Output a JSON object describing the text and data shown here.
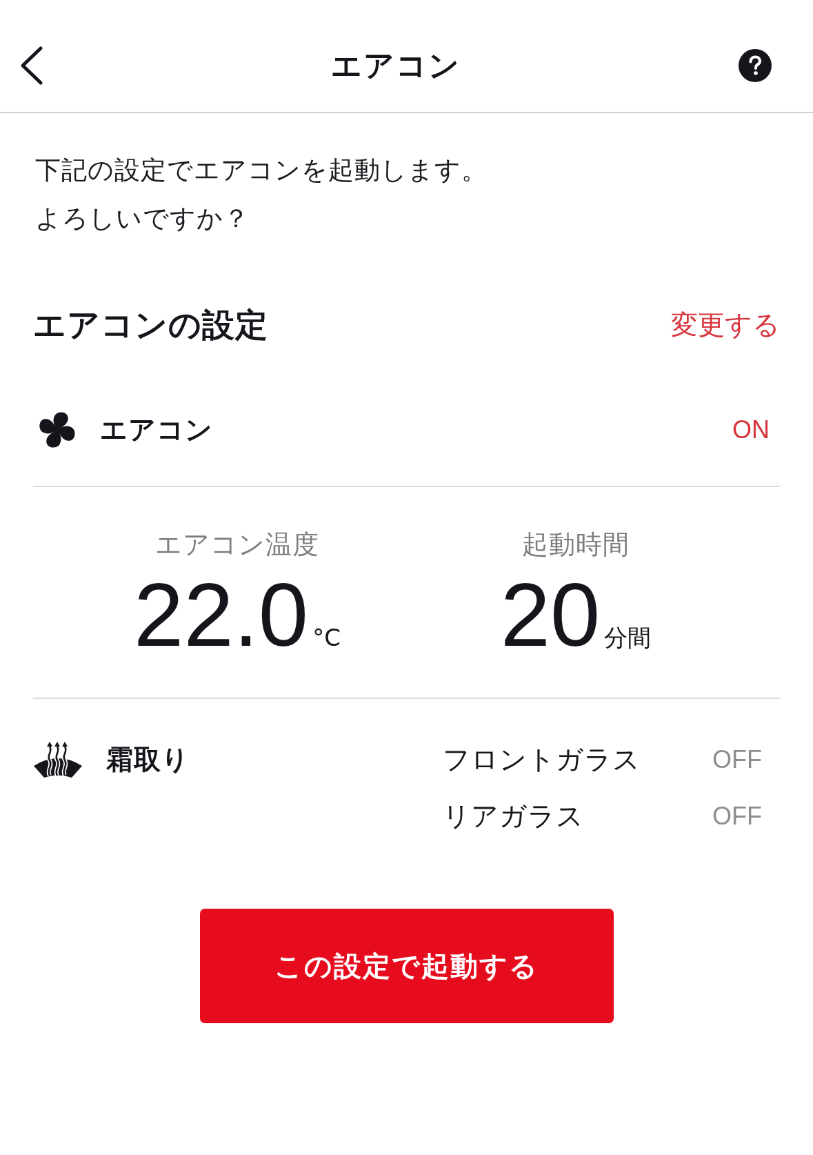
{
  "header": {
    "title": "エアコン"
  },
  "intro": {
    "lines": [
      "下記の設定でエアコンを起動します。",
      "よろしいですか？"
    ]
  },
  "settings": {
    "title": "エアコンの設定",
    "change_link": "変更する"
  },
  "aircon": {
    "label": "エアコン",
    "status": "ON",
    "on": true
  },
  "readings": [
    {
      "label": "エアコン温度",
      "value": "22.0",
      "unit": "°C"
    },
    {
      "label": "起動時間",
      "value": "20",
      "unit": "分間"
    }
  ],
  "defrost": {
    "label": "霜取り",
    "items": [
      {
        "label": "フロントガラス",
        "status": "OFF",
        "on": false
      },
      {
        "label": "リアガラス",
        "status": "OFF",
        "on": false
      }
    ]
  },
  "start_button": {
    "label": "この設定で起動する"
  }
}
